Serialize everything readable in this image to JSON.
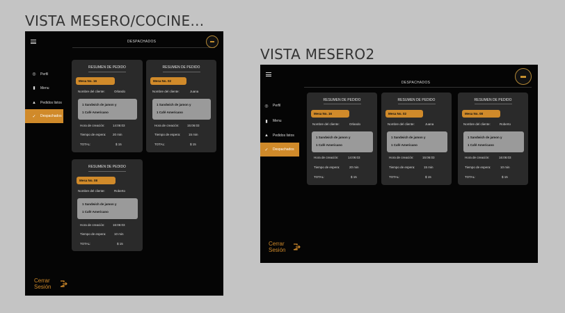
{
  "frames": [
    {
      "title": "VISTA MESERO/COCINE...",
      "header": "DESPACHADOS",
      "sidebar": [
        "Perfil",
        "Menu",
        "Pedidos listos",
        "Despachados"
      ],
      "logout": "Cerrar Sesión"
    },
    {
      "title": "VISTA MESERO2",
      "header": "DESPACHADOS",
      "sidebar": [
        "Perfil",
        "Menu",
        "Pedidos listos",
        "Despachados"
      ],
      "logout": "Cerrar Sesión"
    }
  ],
  "labels": {
    "summary": "RESUMEN DE PEDIDO",
    "client": "Nombre del cliente:",
    "created": "Hora de creación:",
    "wait": "Tiempo de espera:",
    "total": "TOTAL:"
  },
  "orders": [
    {
      "mesa": "Mesa No. 16",
      "client": "Orlando",
      "items": [
        "1 Sandwich de jamon y",
        "1 Café Americano"
      ],
      "created": "14:06:03",
      "wait": "20 min",
      "total": "$ 15"
    },
    {
      "mesa": "Mesa No. 02",
      "client": "Juana",
      "items": [
        "1 Sandwich de jamon y",
        "1 Café Americano"
      ],
      "created": "15:06:03",
      "wait": "15 min",
      "total": "$ 15"
    },
    {
      "mesa": "Mesa No. 08",
      "client": "Roberto",
      "items": [
        "1 Sandwich de jamon y",
        "1 Café Americano"
      ],
      "created": "16:06:03",
      "wait": "10 min",
      "total": "$ 15"
    }
  ],
  "icons": [
    "menu-icon",
    "user-icon",
    "book-icon",
    "bell-icon",
    "check-icon",
    "exit-icon"
  ],
  "colors": {
    "accent": "#d08a2a",
    "background": "#050505",
    "card": "#2a2a2a",
    "order_box": "#9a9a9a"
  }
}
